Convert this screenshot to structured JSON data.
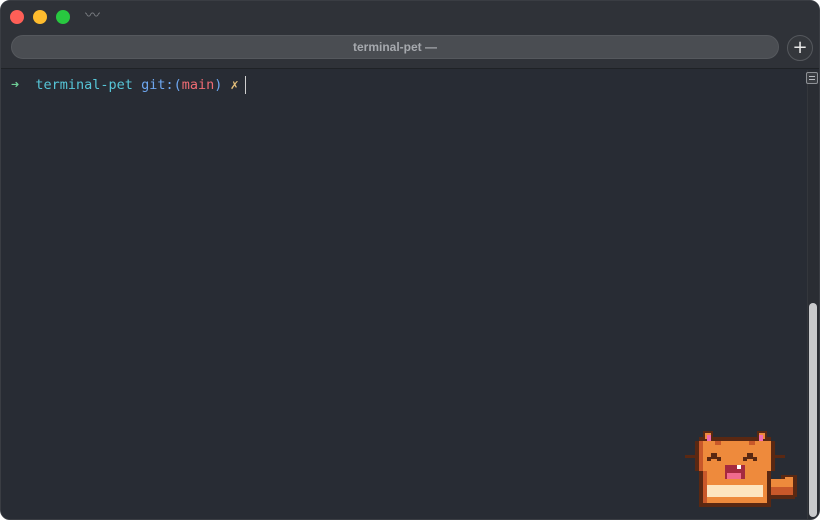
{
  "window": {
    "tab_title": "terminal-pet —",
    "new_tab_label": "+",
    "wave_glyph": "〰"
  },
  "terminal": {
    "prompt_arrow": "➜",
    "directory": "terminal-pet",
    "git_prefix": "git:(",
    "branch": "main",
    "git_suffix": ")",
    "dirty_marker": "✗"
  },
  "pet": {
    "icon": "cat-icon",
    "colors": {
      "outline": "#5a2812",
      "fur": "#ee8a3c",
      "fur_dark": "#c8582a",
      "ear_inner": "#f06bb0",
      "belly": "#fde5c0",
      "mouth": "#a52a3f",
      "tongue": "#f06b8e",
      "tooth": "#ffffff"
    }
  },
  "colors": {
    "background": "#282c34",
    "arrow": "#6fcf97",
    "directory": "#56c6d8",
    "git": "#6ea7f0",
    "branch": "#ef6b73",
    "dirty": "#e5c07b"
  }
}
